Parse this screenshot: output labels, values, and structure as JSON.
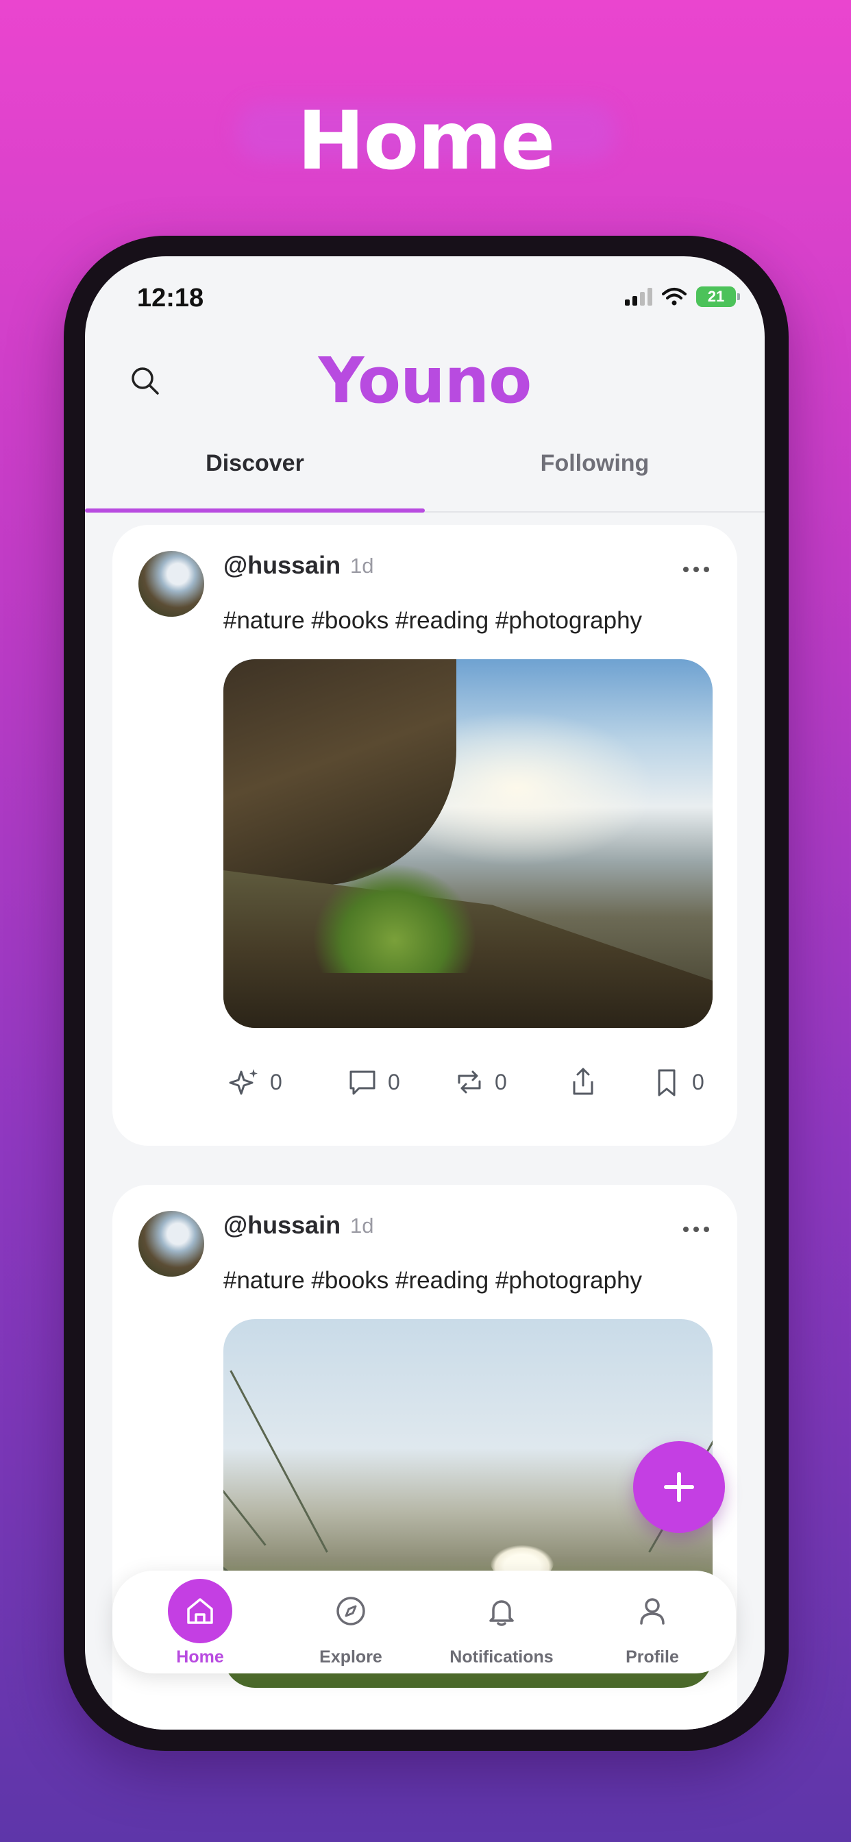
{
  "hero": {
    "title": "Home"
  },
  "status_bar": {
    "time": "12:18",
    "battery": "21"
  },
  "app": {
    "brand": "Youno"
  },
  "tabs": [
    {
      "label": "Discover",
      "active": true
    },
    {
      "label": "Following",
      "active": false
    }
  ],
  "posts": [
    {
      "username": "@hussain",
      "time": "1d",
      "tags": "#nature #books #reading #photography",
      "image": "waterfall-photo",
      "counts": {
        "sparkle": "0",
        "comment": "0",
        "repost": "0",
        "bookmark": "0"
      }
    },
    {
      "username": "@hussain",
      "time": "1d",
      "tags": "#nature #books #reading #photography",
      "image": "grass-flower-photo"
    }
  ],
  "bottom_nav": [
    {
      "label": "Home",
      "icon": "home-icon",
      "active": true
    },
    {
      "label": "Explore",
      "icon": "compass-icon",
      "active": false
    },
    {
      "label": "Notifications",
      "icon": "bell-icon",
      "active": false
    },
    {
      "label": "Profile",
      "icon": "user-icon",
      "active": false
    }
  ],
  "colors": {
    "accent": "#B84BE0",
    "fab": "#C43FE3",
    "battery": "#4CC25A"
  }
}
